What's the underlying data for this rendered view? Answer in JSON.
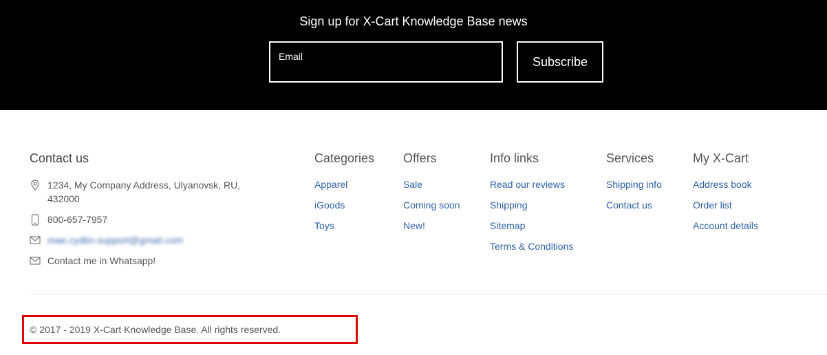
{
  "newsletter": {
    "title": "Sign up for X-Cart Knowledge Base news",
    "email_placeholder": "Email",
    "email_value": "",
    "subscribe_label": "Subscribe"
  },
  "contact": {
    "title": "Contact us",
    "address": "1234, My Company Address, Ulyanovsk, RU, 432000",
    "phone": "800-657-7957",
    "email": "mae.cydtin-support@gmail.com",
    "whatsapp": "Contact me in Whatsapp!"
  },
  "columns": [
    {
      "title": "Categories",
      "links": [
        "Apparel",
        "iGoods",
        "Toys"
      ]
    },
    {
      "title": "Offers",
      "links": [
        "Sale",
        "Coming soon",
        "New!"
      ]
    },
    {
      "title": "Info links",
      "links": [
        "Read our reviews",
        "Shipping",
        "Sitemap",
        "Terms & Conditions"
      ]
    },
    {
      "title": "Services",
      "links": [
        "Shipping info",
        "Contact us"
      ]
    },
    {
      "title": "My X-Cart",
      "links": [
        "Address book",
        "Order list",
        "Account details"
      ]
    }
  ],
  "footer": {
    "copyright": "© 2017 - 2019 X-Cart Knowledge Base. All rights reserved."
  },
  "colors": {
    "link": "#2e62a8",
    "text": "#555555",
    "highlight": "#e00000",
    "newsletter_bg": "#000000"
  },
  "icons": {
    "address": "map-pin-icon",
    "phone": "mobile-phone-icon",
    "email": "envelope-icon",
    "whatsapp": "envelope-icon"
  }
}
